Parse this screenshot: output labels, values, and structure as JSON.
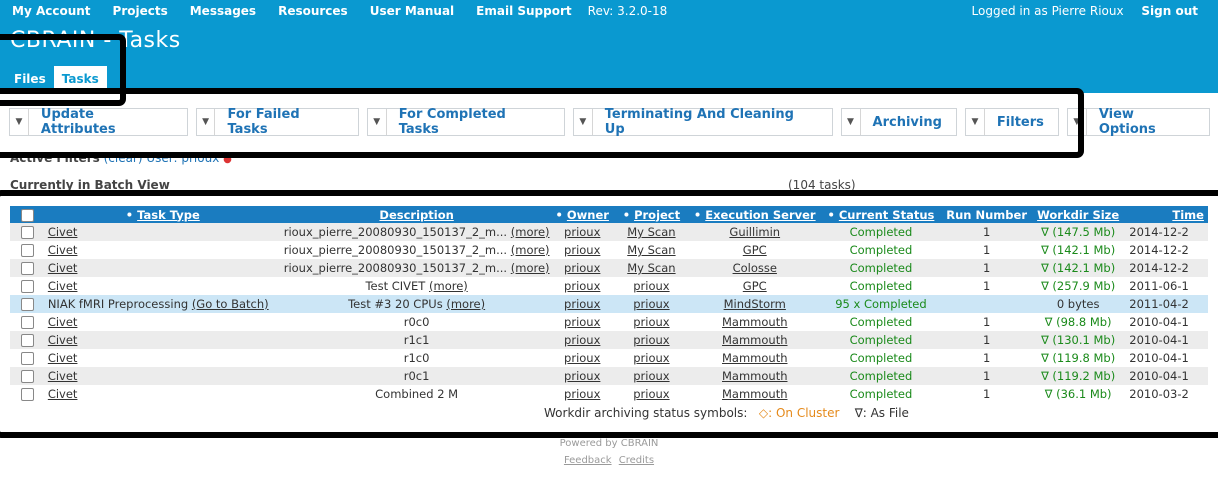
{
  "topnav": {
    "items": [
      "My Account",
      "Projects",
      "Messages",
      "Resources",
      "User Manual",
      "Email Support"
    ],
    "revision": "Rev: 3.2.0-18",
    "logged_in": "Logged in as Pierre Rioux",
    "sign_out": "Sign out"
  },
  "app_title": "CBRAIN - Tasks",
  "tabs": [
    "Files",
    "Tasks"
  ],
  "toolbar": [
    "Update Attributes",
    "For Failed Tasks",
    "For Completed Tasks",
    "Terminating And Cleaning Up",
    "Archiving",
    "Filters",
    "View Options"
  ],
  "active_filters": {
    "label": "Active Filters",
    "clear": "(clear)",
    "filter": "User: prioux"
  },
  "batch_view": "Currently in Batch View",
  "task_count": "(104 tasks)",
  "table": {
    "headers": [
      "Task Type",
      "Description",
      "Owner",
      "Project",
      "Execution Server",
      "Current Status",
      "Run Number",
      "Workdir Size",
      "Time"
    ],
    "rows": [
      {
        "type": "Civet",
        "desc": "rioux_pierre_20080930_150137_2_m...",
        "more": "(more)",
        "owner": "prioux",
        "project": "My Scan",
        "server": "Guillimin",
        "status": "Completed",
        "run": "1",
        "size": "∇ (147.5 Mb)",
        "time": "2014-12-2"
      },
      {
        "type": "Civet",
        "desc": "rioux_pierre_20080930_150137_2_m...",
        "more": "(more)",
        "owner": "prioux",
        "project": "My Scan",
        "server": "GPC",
        "status": "Completed",
        "run": "1",
        "size": "∇ (142.1 Mb)",
        "time": "2014-12-2"
      },
      {
        "type": "Civet",
        "desc": "rioux_pierre_20080930_150137_2_m...",
        "more": "(more)",
        "owner": "prioux",
        "project": "My Scan",
        "server": "Colosse",
        "status": "Completed",
        "run": "1",
        "size": "∇ (142.1 Mb)",
        "time": "2014-12-2"
      },
      {
        "type": "Civet",
        "desc": "Test CIVET",
        "more": "(more)",
        "owner": "prioux",
        "project": "prioux",
        "server": "GPC",
        "status": "Completed",
        "run": "1",
        "size": "∇ (257.9 Mb)",
        "time": "2011-06-1"
      },
      {
        "type": "NIAK fMRI Preprocessing",
        "batch_link": "(Go to Batch)",
        "desc": "Test #3 20 CPUs",
        "more": "(more)",
        "owner": "prioux",
        "project": "prioux",
        "server": "MindStorm",
        "status": "95 x Completed",
        "run": "",
        "size": "0 bytes",
        "time": "2011-04-2"
      },
      {
        "type": "Civet",
        "desc": "r0c0",
        "more": "",
        "owner": "prioux",
        "project": "prioux",
        "server": "Mammouth",
        "status": "Completed",
        "run": "1",
        "size": "∇ (98.8 Mb)",
        "time": "2010-04-1"
      },
      {
        "type": "Civet",
        "desc": "r1c1",
        "more": "",
        "owner": "prioux",
        "project": "prioux",
        "server": "Mammouth",
        "status": "Completed",
        "run": "1",
        "size": "∇ (130.1 Mb)",
        "time": "2010-04-1"
      },
      {
        "type": "Civet",
        "desc": "r1c0",
        "more": "",
        "owner": "prioux",
        "project": "prioux",
        "server": "Mammouth",
        "status": "Completed",
        "run": "1",
        "size": "∇ (119.8 Mb)",
        "time": "2010-04-1"
      },
      {
        "type": "Civet",
        "desc": "r0c1",
        "more": "",
        "owner": "prioux",
        "project": "prioux",
        "server": "Mammouth",
        "status": "Completed",
        "run": "1",
        "size": "∇ (119.2 Mb)",
        "time": "2010-04-1"
      },
      {
        "type": "Civet",
        "desc": "Combined 2 M",
        "more": "",
        "owner": "prioux",
        "project": "prioux",
        "server": "Mammouth",
        "status": "Completed",
        "run": "1",
        "size": "∇ (36.1 Mb)",
        "time": "2010-03-2"
      }
    ]
  },
  "legend": {
    "label": "Workdir archiving status symbols:",
    "cluster": "◇: On Cluster",
    "file": "∇: As File"
  },
  "footer": {
    "powered": "Powered by CBRAIN",
    "feedback": "Feedback",
    "credits": "Credits"
  },
  "colors": {
    "header_blue": "#0a99d0",
    "table_header": "#1a7cc0",
    "link": "#1f73b5",
    "completed": "#1a8a1a"
  }
}
